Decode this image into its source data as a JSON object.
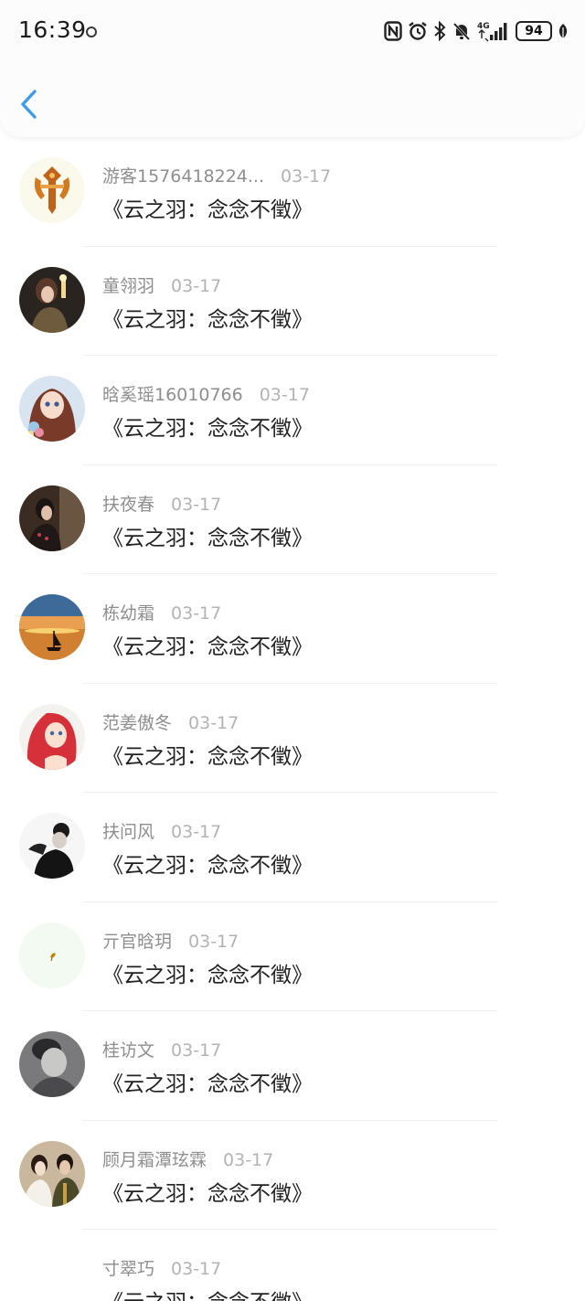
{
  "status_bar": {
    "time": "16:39",
    "network": "4G",
    "battery": "94"
  },
  "nav": {
    "back_label": ""
  },
  "comments": [
    {
      "name": "游客1576418224...",
      "date": "03-17",
      "title": "《云之羽：念念不徵》"
    },
    {
      "name": "童翎羽",
      "date": "03-17",
      "title": "《云之羽：念念不徵》"
    },
    {
      "name": "晗奚瑶16010766",
      "date": "03-17",
      "title": "《云之羽：念念不徵》"
    },
    {
      "name": "扶夜春",
      "date": "03-17",
      "title": "《云之羽：念念不徵》"
    },
    {
      "name": "栋幼霜",
      "date": "03-17",
      "title": "《云之羽：念念不徵》"
    },
    {
      "name": "范姜傲冬",
      "date": "03-17",
      "title": "《云之羽：念念不徵》"
    },
    {
      "name": "扶问风",
      "date": "03-17",
      "title": "《云之羽：念念不徵》"
    },
    {
      "name": "亓官晗玥",
      "date": "03-17",
      "title": "《云之羽：念念不徵》"
    },
    {
      "name": "桂访文",
      "date": "03-17",
      "title": "《云之羽：念念不徵》"
    },
    {
      "name": "顾月霜潭玹霖",
      "date": "03-17",
      "title": "《云之羽：念念不徵》"
    },
    {
      "name": "寸翠巧",
      "date": "03-17",
      "title": "《云之羽：念念不徵》"
    }
  ],
  "colors": {
    "accent": "#3d9be9",
    "name_text": "#8e8e90",
    "date_text": "#b3b3b5",
    "title_text": "#222222"
  }
}
